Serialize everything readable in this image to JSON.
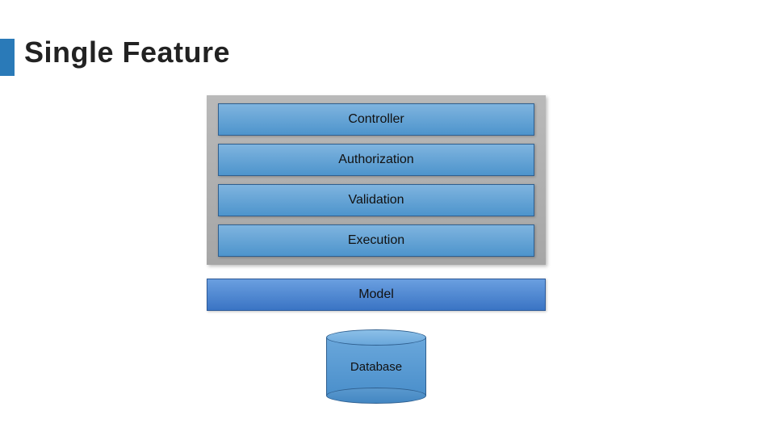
{
  "title": "Single Feature",
  "layers": {
    "controller": "Controller",
    "authorization": "Authorization",
    "validation": "Validation",
    "execution": "Execution"
  },
  "model": "Model",
  "database": "Database",
  "colors": {
    "accent": "#2a7ab8",
    "layer_light": "#5c9fd4",
    "model_blue": "#4b80cc",
    "stack_bg": "#a8a8a8"
  }
}
